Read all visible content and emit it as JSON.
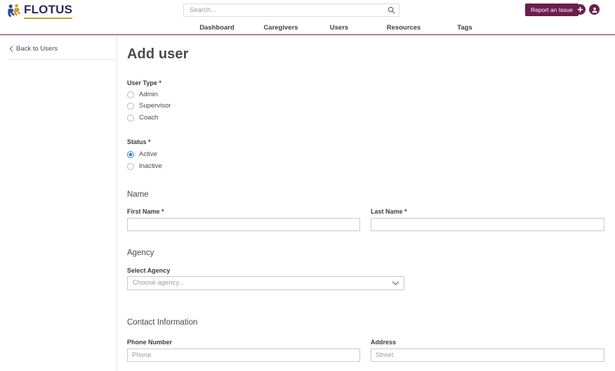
{
  "brand": {
    "name": "FLOTUS",
    "logo_icon": "flotus-figure-icon",
    "text_color": "#2b2b5e",
    "accent_color": "#c9a227"
  },
  "topbar": {
    "search": {
      "placeholder": "Search...",
      "value": "",
      "icon": "search-icon"
    },
    "report_button": {
      "label": "Report an Issue",
      "color": "#6b1d4e"
    },
    "add_icon": "plus-circle-icon",
    "account_icon": "account-circle-icon"
  },
  "nav": {
    "accent_color": "#6b2a52",
    "items": [
      {
        "label": "Dashboard"
      },
      {
        "label": "Caregivers"
      },
      {
        "label": "Users"
      },
      {
        "label": "Resources"
      },
      {
        "label": "Tags"
      }
    ]
  },
  "sidebar": {
    "back_link": {
      "label": "Back to Users",
      "icon": "chevron-left-icon"
    }
  },
  "main": {
    "title": "Add user",
    "user_type": {
      "label": "User Type *",
      "options": [
        {
          "label": "Admin",
          "selected": false
        },
        {
          "label": "Supervisor",
          "selected": false
        },
        {
          "label": "Coach",
          "selected": false
        }
      ]
    },
    "status": {
      "label": "Status *",
      "options": [
        {
          "label": "Active",
          "selected": true
        },
        {
          "label": "Inactive",
          "selected": false
        }
      ]
    },
    "name_section": {
      "heading": "Name",
      "first_name": {
        "label": "First Name *",
        "value": "",
        "placeholder": ""
      },
      "last_name": {
        "label": "Last Name *",
        "value": "",
        "placeholder": ""
      }
    },
    "agency_section": {
      "heading": "Agency",
      "select_label": "Select Agency",
      "select_value": "Choose agency...",
      "chevron_icon": "chevron-down-icon"
    },
    "contact_section": {
      "heading": "Contact Information",
      "phone": {
        "label": "Phone Number",
        "value": "",
        "placeholder": "Phone"
      },
      "address": {
        "label": "Address",
        "value": "",
        "placeholder": "Street"
      }
    }
  }
}
